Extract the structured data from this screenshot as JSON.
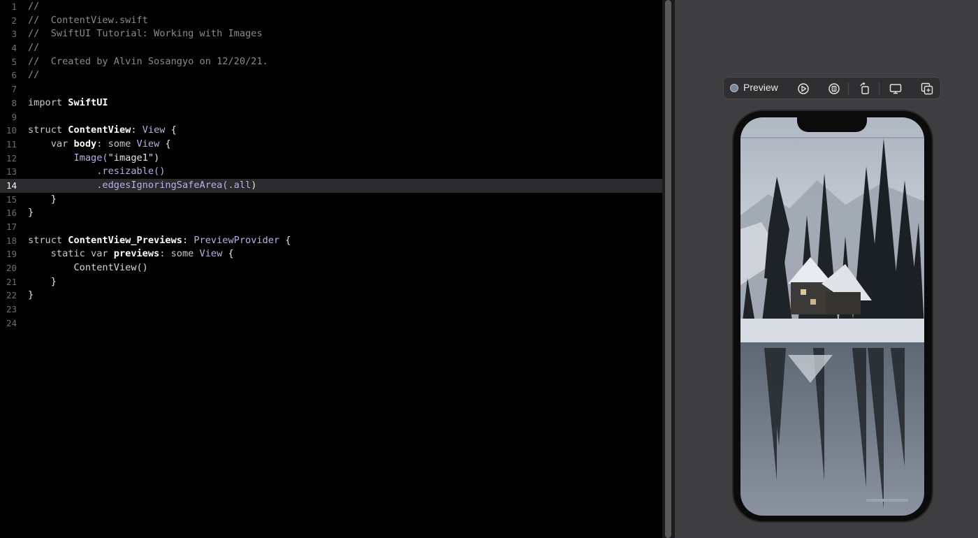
{
  "editor": {
    "current_line": "14",
    "lines": [
      {
        "num": "1",
        "t0": "//"
      },
      {
        "num": "2",
        "t0": "//  ContentView.swift"
      },
      {
        "num": "3",
        "t0": "//  SwiftUI Tutorial: Working with Images"
      },
      {
        "num": "4",
        "t0": "//"
      },
      {
        "num": "5",
        "t0": "//  Created by Alvin Sosangyo on 12/20/21."
      },
      {
        "num": "6",
        "t0": "//"
      },
      {
        "num": "7"
      },
      {
        "num": "8",
        "t0": "import ",
        "t1": "SwiftUI"
      },
      {
        "num": "9"
      },
      {
        "num": "10",
        "t0": "struct ",
        "t1": "ContentView",
        "t2": ": ",
        "t3": "View",
        "t4": " {"
      },
      {
        "num": "11",
        "t0": "    var ",
        "t1": "body",
        "t2": ": some ",
        "t3": "View",
        "t4": " {"
      },
      {
        "num": "12",
        "t0": "        Image(",
        "t1": "\"image1\"",
        "t2": ")"
      },
      {
        "num": "13",
        "t0": "            .resizable()"
      },
      {
        "num": "14",
        "t0": "            .edgesIgnoringSafeArea(",
        "t1": ".all",
        "t2": ")"
      },
      {
        "num": "15",
        "t0": "    }"
      },
      {
        "num": "16",
        "t0": "}"
      },
      {
        "num": "17"
      },
      {
        "num": "18",
        "t0": "struct ",
        "t1": "ContentView_Previews",
        "t2": ": ",
        "t3": "PreviewProvider",
        "t4": " {"
      },
      {
        "num": "19",
        "t0": "    static var ",
        "t1": "previews",
        "t2": ": some ",
        "t3": "View",
        "t4": " {"
      },
      {
        "num": "20",
        "t0": "        ContentView()"
      },
      {
        "num": "21",
        "t0": "    }"
      },
      {
        "num": "22",
        "t0": "}"
      },
      {
        "num": "23"
      },
      {
        "num": "24"
      }
    ]
  },
  "preview": {
    "label": "Preview",
    "buttons": [
      "live-preview-icon",
      "pin-preview-icon",
      "rotate-device-icon",
      "device-settings-icon",
      "duplicate-preview-icon"
    ]
  },
  "colors": {
    "editor_bg": "#000000",
    "canvas_bg": "#3e3e40",
    "type_color": "#b9b0e6",
    "current_line_bg": "#2b2b2e"
  }
}
